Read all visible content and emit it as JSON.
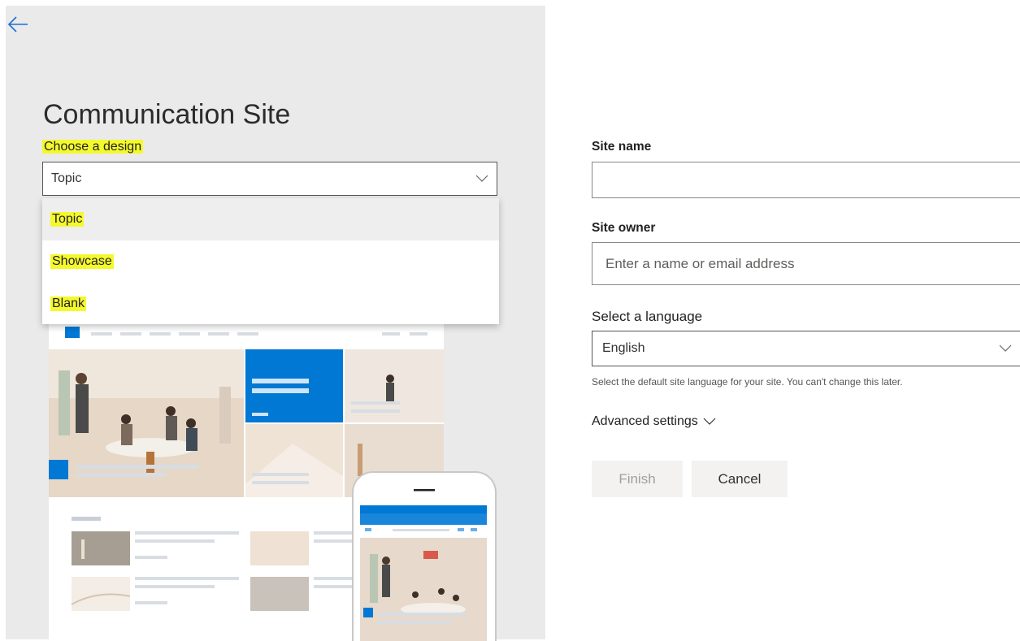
{
  "left": {
    "title": "Communication Site",
    "design_label": "Choose a design",
    "design_select": {
      "value": "Topic"
    },
    "design_options": [
      "Topic",
      "Showcase",
      "Blank"
    ]
  },
  "form": {
    "site_name": {
      "label": "Site name",
      "value": ""
    },
    "site_owner": {
      "label": "Site owner",
      "placeholder": "Enter a name or email address"
    },
    "language": {
      "label": "Select a language",
      "value": "English",
      "help": "Select the default site language for your site. You can't change this later."
    },
    "advanced_label": "Advanced settings",
    "finish_label": "Finish",
    "cancel_label": "Cancel"
  },
  "icons": {
    "back": "arrow-left-icon",
    "chevron": "chevron-down-icon"
  },
  "colors": {
    "accent": "#0078d4",
    "highlight": "#f4f92c",
    "panel_bg": "#eaeaea"
  }
}
